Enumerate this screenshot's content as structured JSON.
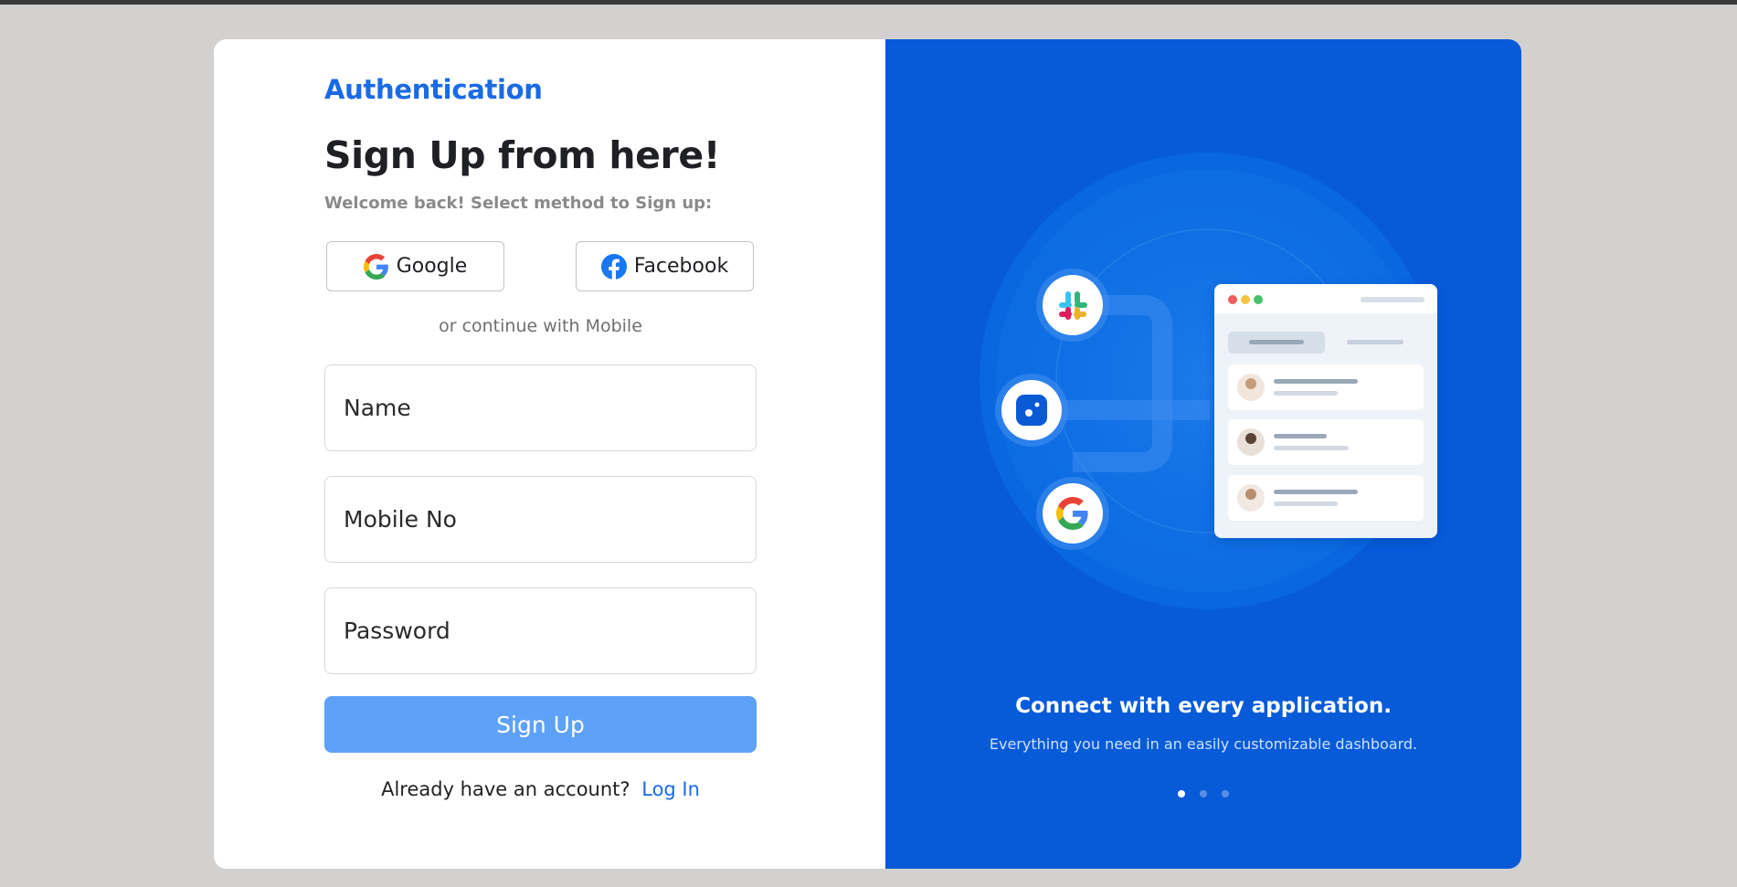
{
  "app": {
    "brand": "Authentication"
  },
  "form": {
    "title": "Sign Up from here!",
    "subtitle": "Welcome back! Select method to Sign up:",
    "social": {
      "google_label": "Google",
      "facebook_label": "Facebook"
    },
    "divider": "or continue with Mobile",
    "fields": {
      "name_placeholder": "Name",
      "mobile_placeholder": "Mobile No",
      "password_placeholder": "Password"
    },
    "submit_label": "Sign Up",
    "login_prompt": "Already have an account?",
    "login_link": "Log In"
  },
  "promo": {
    "title": "Connect with every application.",
    "subtitle": "Everything you need in an easily customizable dashboard.",
    "slides": 3,
    "active_slide": 0,
    "icons": [
      "slack-icon",
      "app-icon",
      "google-icon"
    ]
  },
  "colors": {
    "brand": "#1a6ae6",
    "panel": "#075bd9",
    "button": "#5ea1f8",
    "background": "#d2d1cf"
  }
}
